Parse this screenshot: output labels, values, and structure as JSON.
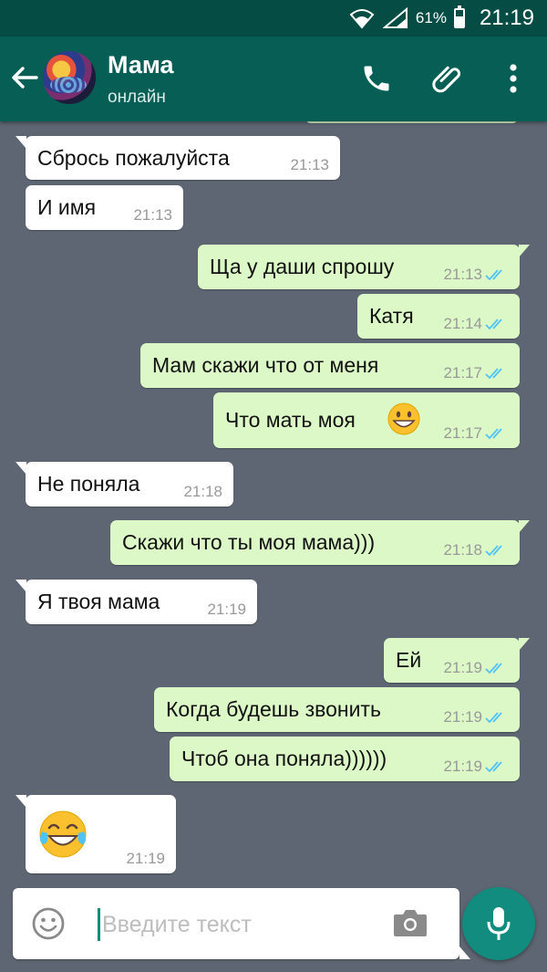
{
  "statusbar": {
    "battery": "61%",
    "time": "21:19"
  },
  "header": {
    "name": "Мама",
    "status": "онлайн"
  },
  "colors": {
    "header": "#075e54",
    "statusbar": "#054d44",
    "outgoing": "#dcf8c6",
    "incoming": "#ffffff",
    "accent": "#128c7e",
    "tick_read": "#4fc3f7"
  },
  "icons": {
    "back": "arrow-left-icon",
    "call": "phone-icon",
    "attach": "paperclip-icon",
    "menu": "more-vert-icon",
    "emoji": "smiley-icon",
    "camera": "camera-icon",
    "mic": "mic-icon"
  },
  "messages": [
    {
      "dir": "in",
      "text": "Сбрось пожалуйста",
      "time": "21:13"
    },
    {
      "dir": "in",
      "text": "И имя",
      "time": "21:13"
    },
    {
      "dir": "out",
      "text": "Ща у даши спрошу",
      "time": "21:13",
      "status": "read"
    },
    {
      "dir": "out",
      "text": "Катя",
      "time": "21:14",
      "status": "read"
    },
    {
      "dir": "out",
      "text": "Мам скажи что от меня",
      "time": "21:17",
      "status": "read"
    },
    {
      "dir": "out",
      "text": "Что мать моя",
      "emoji": "grinning-face",
      "time": "21:17",
      "status": "read"
    },
    {
      "dir": "in",
      "text": "Не поняла",
      "time": "21:18"
    },
    {
      "dir": "out",
      "text": "Скажи что ты моя мама)))",
      "time": "21:18",
      "status": "read"
    },
    {
      "dir": "in",
      "text": "Я твоя мама",
      "time": "21:19"
    },
    {
      "dir": "out",
      "text": "Ей",
      "time": "21:19",
      "status": "read"
    },
    {
      "dir": "out",
      "text": "Когда будешь звонить",
      "time": "21:19",
      "status": "read"
    },
    {
      "dir": "out",
      "text": "Чтоб она поняла))))))",
      "time": "21:19",
      "status": "read"
    },
    {
      "dir": "in",
      "emoji": "face-with-tears-of-joy",
      "time": "21:19"
    }
  ],
  "composer": {
    "placeholder": "Введите текст"
  }
}
